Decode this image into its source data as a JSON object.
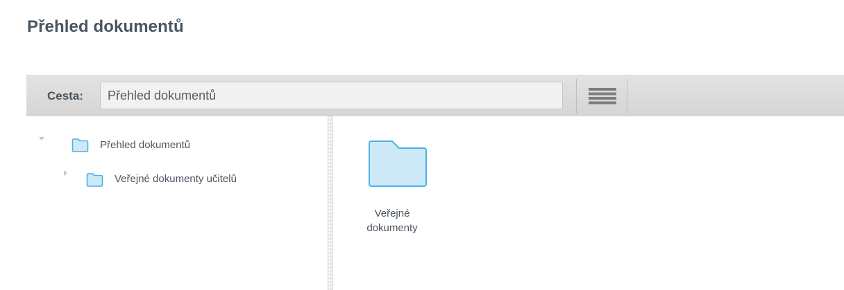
{
  "page": {
    "title": "Přehled dokumentů"
  },
  "toolbar": {
    "path_label": "Cesta:",
    "path_value": "Přehled dokumentů",
    "view_toggle_icon": "list-view-icon"
  },
  "tree": {
    "items": [
      {
        "label": "Přehled dokumentů",
        "expanded": true,
        "icon": "folder-icon"
      },
      {
        "label": "Veřejné dokumenty učitelů",
        "expanded": false,
        "icon": "folder-icon"
      }
    ]
  },
  "content": {
    "items": [
      {
        "label_line1": "Veřejné",
        "label_line2": "dokumenty",
        "icon": "folder-icon"
      }
    ]
  },
  "colors": {
    "folder_fill": "#cde9f7",
    "folder_stroke": "#4cb1e3",
    "text": "#4a5560",
    "toolbar_bg": "#dcdcdc"
  }
}
